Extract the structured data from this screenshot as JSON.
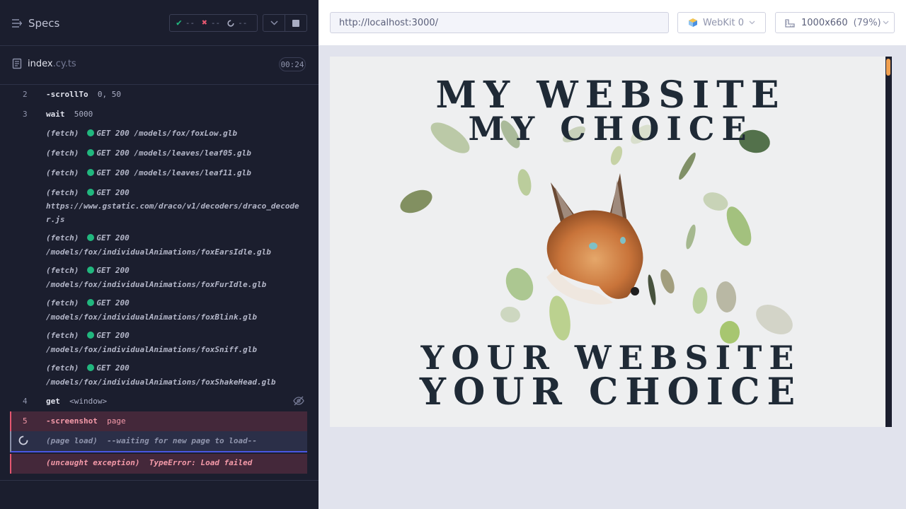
{
  "reporter": {
    "specs_label": "Specs",
    "stats": {
      "passed": "--",
      "failed": "--",
      "pending": "--"
    },
    "spec_name": "index",
    "spec_ext": ".cy.ts",
    "duration": "00:24"
  },
  "commands": [
    {
      "number": "2",
      "name": "-scrollTo",
      "args": "0, 50"
    },
    {
      "number": "3",
      "name": "wait",
      "args": "5000"
    }
  ],
  "fetches": [
    {
      "label": "(fetch)",
      "method": "GET 200",
      "url": "/models/fox/foxLow.glb"
    },
    {
      "label": "(fetch)",
      "method": "GET 200",
      "url": "/models/leaves/leaf05.glb"
    },
    {
      "label": "(fetch)",
      "method": "GET 200",
      "url": "/models/leaves/leaf11.glb"
    },
    {
      "label": "(fetch)",
      "method": "GET 200",
      "url": "https://www.gstatic.com/draco/v1/decoders/draco_decoder.js"
    },
    {
      "label": "(fetch)",
      "method": "GET 200",
      "url": "/models/fox/individualAnimations/foxEarsIdle.glb"
    },
    {
      "label": "(fetch)",
      "method": "GET 200",
      "url": "/models/fox/individualAnimations/foxFurIdle.glb"
    },
    {
      "label": "(fetch)",
      "method": "GET 200",
      "url": "/models/fox/individualAnimations/foxBlink.glb"
    },
    {
      "label": "(fetch)",
      "method": "GET 200",
      "url": "/models/fox/individualAnimations/foxSniff.glb"
    },
    {
      "label": "(fetch)",
      "method": "GET 200",
      "url": "/models/fox/individualAnimations/foxShakeHead.glb"
    }
  ],
  "get_command": {
    "number": "4",
    "name": "get",
    "args": "<window>"
  },
  "screenshot_command": {
    "number": "5",
    "name": "-screenshot",
    "args": "page"
  },
  "page_load": {
    "label": "(page load)",
    "text": "--waiting for new page to load--"
  },
  "exception": {
    "label": "(uncaught exception)",
    "text": "TypeError: Load failed"
  },
  "aut": {
    "url": "http://localhost:3000/",
    "browser": "WebKit 0",
    "viewport": "1000x660",
    "zoom": "(79%)"
  },
  "website": {
    "line1": "MY WEBSITE",
    "line2": "MY CHOICE",
    "line3": "YOUR WEBSITE",
    "line4": "YOUR CHOICE"
  },
  "colors": {
    "pass": "#21b77e",
    "fail": "#e45770",
    "accent": "#4956e3",
    "scroll_thumb": "#f0a050"
  },
  "icons": [
    "specs-list-icon",
    "check-icon",
    "x-icon",
    "spinner-icon",
    "chevron-down-icon",
    "stop-icon",
    "file-icon",
    "eye-slash-icon",
    "webkit-icon",
    "viewport-ruler-icon"
  ]
}
